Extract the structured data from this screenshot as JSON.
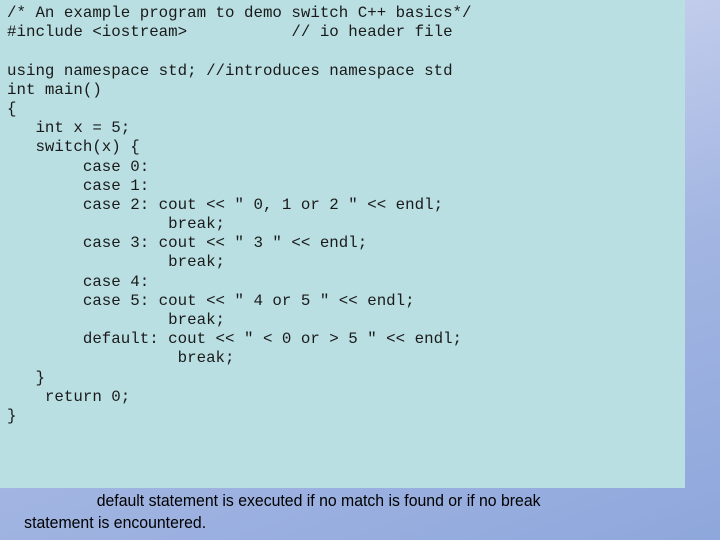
{
  "slide": {
    "code_lines": [
      "/* An example program to demo switch C++ basics*/",
      "#include <iostream>           // io header file",
      "",
      "using namespace std; //introduces namespace std",
      "int main()",
      "{",
      "   int x = 5;",
      "   switch(x) {",
      "        case 0:",
      "        case 1:",
      "        case 2: cout << \" 0, 1 or 2 \" << endl;",
      "                 break;",
      "        case 3: cout << \" 3 \" << endl;",
      "                 break;",
      "        case 4:",
      "        case 5: cout << \" 4 or 5 \" << endl;",
      "                 break;",
      "        default: cout << \" < 0 or > 5 \" << endl;",
      "                  break;",
      "   }",
      "    return 0;",
      "}"
    ],
    "caption": {
      "line1": "default statement is executed if no match is found or if no break",
      "line2": "statement is encountered."
    },
    "colors": {
      "panel_background": "#b9dfe2",
      "background_start": "#dfe2f3",
      "background_end": "#8ea7dc"
    }
  }
}
